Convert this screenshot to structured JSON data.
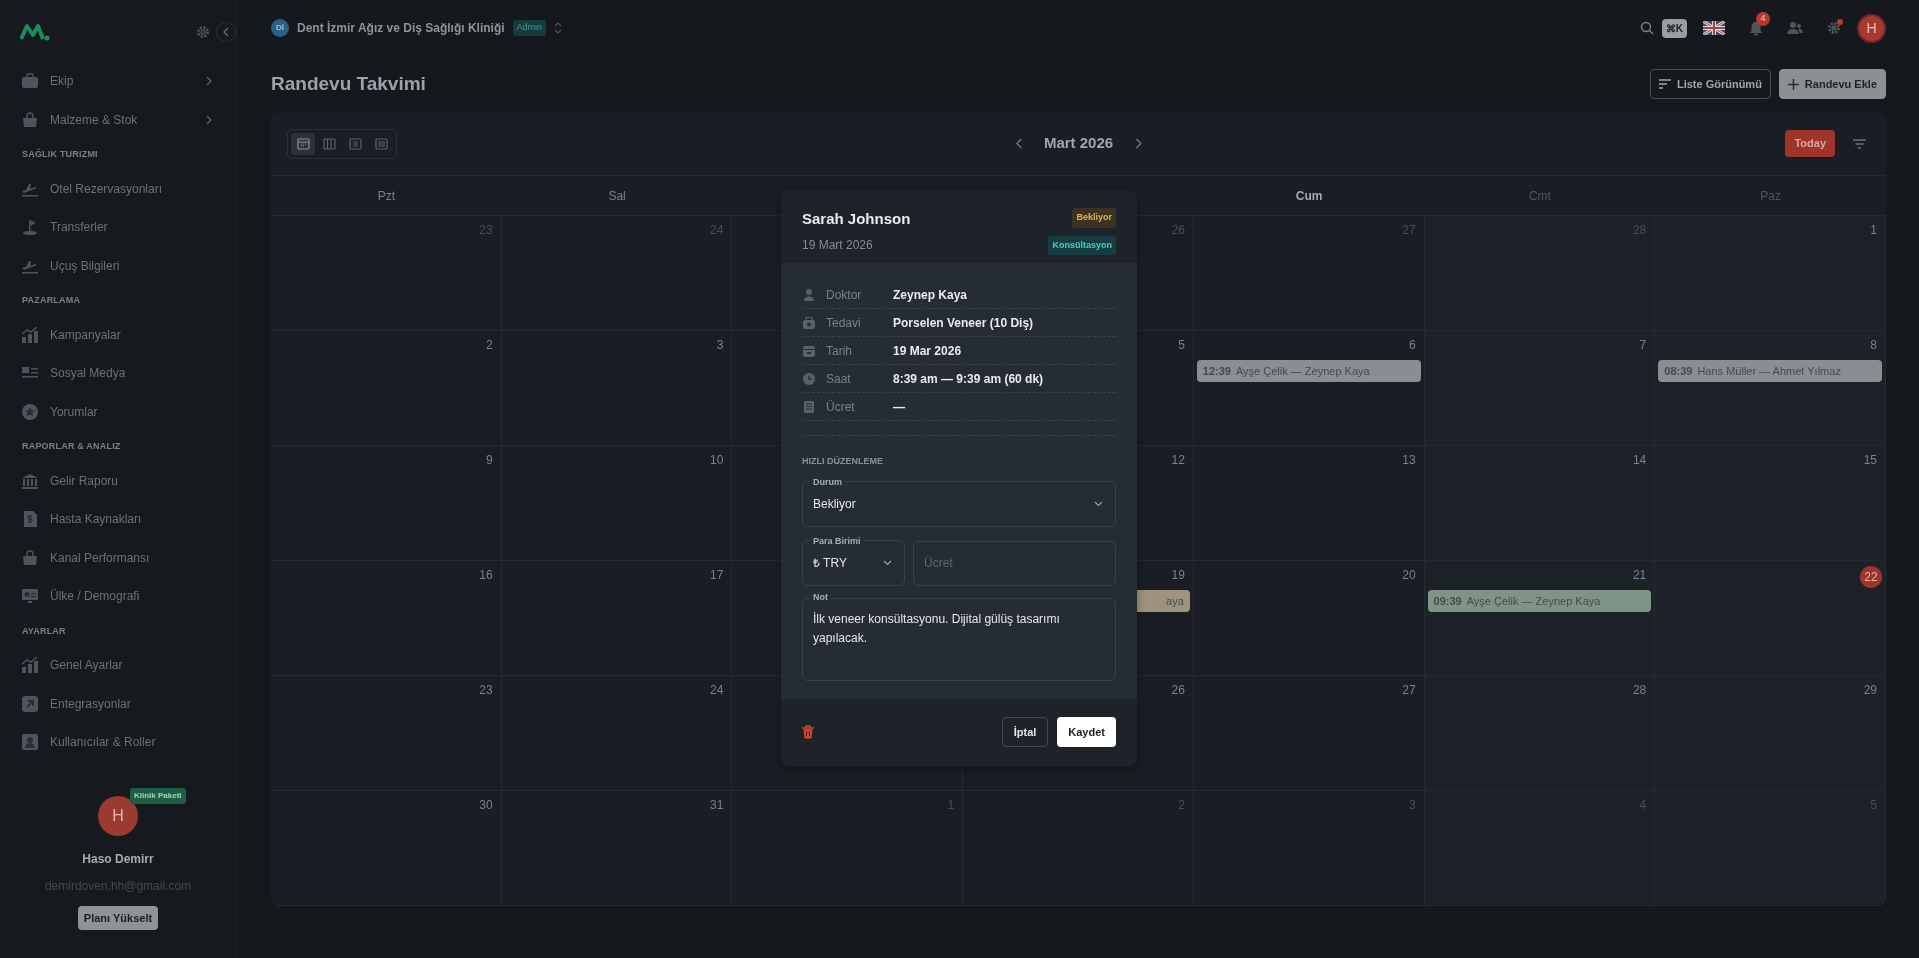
{
  "sidebar": {
    "sections": [
      {
        "items": [
          {
            "label": "Ekip",
            "has_submenu": true
          },
          {
            "label": "Malzeme & Stok",
            "has_submenu": true
          }
        ]
      },
      {
        "heading": "SAĞLIK TURIZMI",
        "items": [
          {
            "label": "Otel Rezervasyonları",
            "has_submenu": false
          },
          {
            "label": "Transferler",
            "has_submenu": false
          },
          {
            "label": "Uçuş Bilgileri",
            "has_submenu": false
          }
        ]
      },
      {
        "heading": "PAZARLAMA",
        "items": [
          {
            "label": "Kampanyalar",
            "has_submenu": false
          },
          {
            "label": "Sosyal Medya",
            "has_submenu": false
          },
          {
            "label": "Yorumlar",
            "has_submenu": false
          }
        ]
      },
      {
        "heading": "RAPORLAR & ANALIZ",
        "items": [
          {
            "label": "Gelir Raporu",
            "has_submenu": false
          },
          {
            "label": "Hasta Kaynakları",
            "has_submenu": false
          },
          {
            "label": "Kanal Performansı",
            "has_submenu": false
          },
          {
            "label": "Ülke / Demografi",
            "has_submenu": false
          }
        ]
      },
      {
        "heading": "AYARLAR",
        "items": [
          {
            "label": "Genel Ayarlar",
            "has_submenu": false
          },
          {
            "label": "Entegrasyonlar",
            "has_submenu": false
          },
          {
            "label": "Kullanıcılar & Roller",
            "has_submenu": false
          }
        ]
      }
    ],
    "user": {
      "initial": "H",
      "plan_badge": "Klinik Paketi",
      "name": "Haso Demirr",
      "email": "demirdoven.hh@gmail.com",
      "upgrade_button": "Planı Yükselt"
    }
  },
  "topbar": {
    "clinic_initials": "Dİ",
    "clinic_name": "Dent İzmir Ağız ve Diş Sağlığı Kliniği",
    "role_badge": "Admin",
    "search_shortcut": "⌘K",
    "notification_count": "4",
    "settings_alert": true,
    "user_initial": "H"
  },
  "page": {
    "title": "Randevu Takvimi",
    "buttons": [
      {
        "label": "Liste Görünümü",
        "kind": "outline"
      },
      {
        "label": "Randevu Ekle",
        "kind": "primary"
      }
    ]
  },
  "calendar": {
    "views": [
      {
        "selected": true
      },
      {
        "selected": false
      },
      {
        "selected": false
      },
      {
        "selected": false
      }
    ],
    "month_label": "Mart 2026",
    "today_button": "Today",
    "weekdays": [
      {
        "label": "Pzt",
        "weekend": false,
        "highlighted": false
      },
      {
        "label": "Sal",
        "weekend": false,
        "highlighted": false
      },
      {
        "kind": "covered"
      },
      {
        "kind": "covered"
      },
      {
        "label": "Cum",
        "weekend": false,
        "highlighted": true
      },
      {
        "label": "Cmt",
        "weekend": true,
        "highlighted": false
      },
      {
        "label": "Paz",
        "weekend": true,
        "highlighted": false
      }
    ],
    "weeks": [
      [
        {
          "day": "23",
          "in_month": false
        },
        {
          "day": "24",
          "in_month": false
        },
        {
          "kind": "covered"
        },
        {
          "day": "26",
          "in_month": false
        },
        {
          "day": "27",
          "in_month": false
        },
        {
          "day": "28",
          "in_month": false
        },
        {
          "day": "1",
          "in_month": true
        }
      ],
      [
        {
          "day": "2",
          "in_month": true
        },
        {
          "day": "3",
          "in_month": true
        },
        {
          "kind": "covered"
        },
        {
          "day": "5",
          "in_month": true
        },
        {
          "day": "6",
          "in_month": true,
          "events": [
            {
              "time": "12:39",
              "title": "Ayşe Çelik — Zeynep Kaya",
              "color": "#8a8d92",
              "cut": false
            }
          ]
        },
        {
          "day": "7",
          "in_month": true
        },
        {
          "day": "8",
          "in_month": true,
          "events": [
            {
              "time": "08:39",
              "title": "Hans Müller — Ahmet Yılmaz",
              "color": "#8a8d92",
              "cut": false
            }
          ]
        }
      ],
      [
        {
          "day": "9",
          "in_month": true
        },
        {
          "day": "10",
          "in_month": true
        },
        {
          "kind": "covered"
        },
        {
          "day": "12",
          "in_month": true
        },
        {
          "day": "13",
          "in_month": true
        },
        {
          "day": "14",
          "in_month": true
        },
        {
          "day": "15",
          "in_month": true
        }
      ],
      [
        {
          "day": "16",
          "in_month": true
        },
        {
          "day": "17",
          "in_month": true
        },
        {
          "kind": "covered"
        },
        {
          "day": "19",
          "in_month": true,
          "events": [
            {
              "title": "aya",
              "color": "#9e937c",
              "cut": true
            }
          ]
        },
        {
          "day": "20",
          "in_month": true
        },
        {
          "day": "21",
          "in_month": true,
          "events": [
            {
              "time": "09:39",
              "title": "Ayşe Çelik — Zeynep Kaya",
              "color": "#7f9487",
              "cut": false
            }
          ]
        },
        {
          "day": "22",
          "in_month": true,
          "today": true
        }
      ],
      [
        {
          "day": "23",
          "in_month": true
        },
        {
          "day": "24",
          "in_month": true
        },
        {
          "kind": "covered"
        },
        {
          "day": "26",
          "in_month": true
        },
        {
          "day": "27",
          "in_month": true
        },
        {
          "day": "28",
          "in_month": true
        },
        {
          "day": "29",
          "in_month": true
        }
      ],
      [
        {
          "day": "30",
          "in_month": true
        },
        {
          "day": "31",
          "in_month": true
        },
        {
          "day": "1",
          "in_month": false
        },
        {
          "day": "2",
          "in_month": false
        },
        {
          "day": "3",
          "in_month": false
        },
        {
          "day": "4",
          "in_month": false
        },
        {
          "day": "5",
          "in_month": false
        }
      ]
    ]
  },
  "modal": {
    "patient": "Sarah Johnson",
    "date": "19 Mart 2026",
    "badges": [
      {
        "label": "Bekliyor",
        "kind": "status"
      },
      {
        "label": "Konsültasyon",
        "kind": "type"
      }
    ],
    "details": [
      {
        "label": "Doktor",
        "value": "Zeynep Kaya"
      },
      {
        "label": "Tedavi",
        "value": "Porselen Veneer (10 Diş)"
      },
      {
        "label": "Tarih",
        "value": "19 Mar 2026"
      },
      {
        "label": "Saat",
        "value": "8:39 am — 9:39 am (60 dk)"
      },
      {
        "label": "Ücret",
        "value": "—"
      }
    ],
    "quick_edit_heading": "HIZLI DÜZENLEME",
    "status_field": {
      "label": "Durum",
      "value": "Bekliyor"
    },
    "currency_field": {
      "label": "Para Birimi",
      "value": "₺ TRY"
    },
    "fee_field": {
      "placeholder": "Ücret"
    },
    "note_field": {
      "label": "Not",
      "value": "İlk veneer konsültasyonu. Dijital gülüş tasarımı yapılacak."
    },
    "cancel_button": "İptal",
    "save_button": "Kaydet"
  }
}
